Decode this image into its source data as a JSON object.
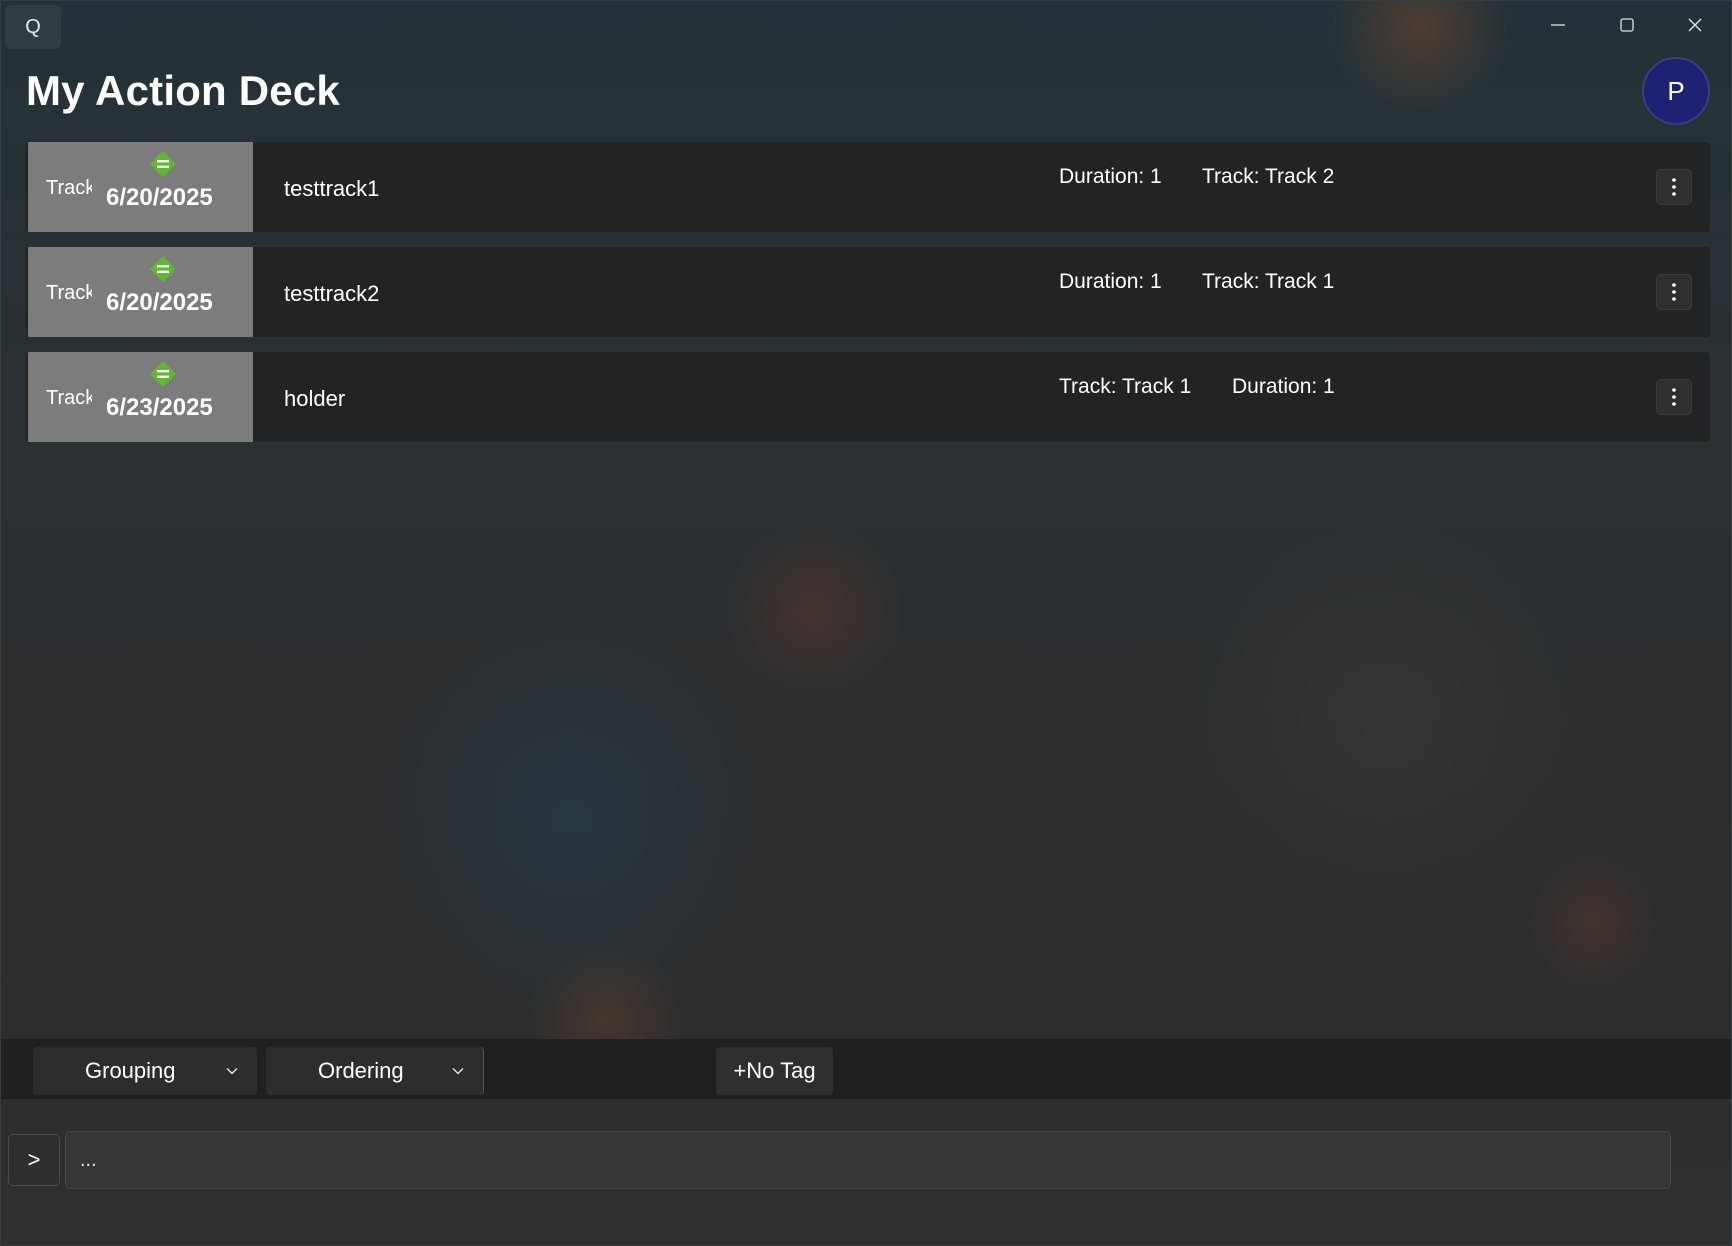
{
  "titlebar": {
    "app_icon_glyph": "Q",
    "controls": [
      "minimize-icon",
      "maximize-icon",
      "close-icon"
    ]
  },
  "header": {
    "title": "My Action Deck",
    "avatar_initial": "P",
    "avatar_color": "#1f2273"
  },
  "items": [
    {
      "kind": "Track",
      "date": "6/20/2025",
      "name": "testtrack1",
      "meta": [
        "Duration: 1",
        "Track: Track 2"
      ],
      "priority_icon": "priority-normal-icon"
    },
    {
      "kind": "Track",
      "date": "6/20/2025",
      "name": "testtrack2",
      "meta": [
        "Duration: 1",
        "Track: Track 1"
      ],
      "priority_icon": "priority-normal-icon"
    },
    {
      "kind": "Track",
      "date": "6/23/2025",
      "name": "holder",
      "meta": [
        "Track: Track 1",
        "Duration: 1"
      ],
      "priority_icon": "priority-normal-icon"
    }
  ],
  "toolbar": {
    "grouping_label": "Grouping",
    "ordering_label": "Ordering",
    "tag_label": "+No Tag"
  },
  "command": {
    "run_label": ">",
    "placeholder": "..."
  },
  "colors": {
    "priority": "#5fb832",
    "card_left": "#7c7c7c",
    "card_bg": "#222324"
  }
}
